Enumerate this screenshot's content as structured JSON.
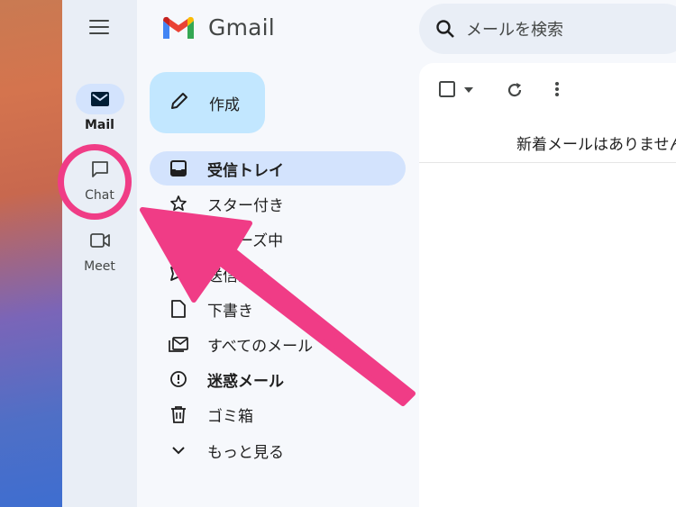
{
  "rail": {
    "items": [
      {
        "label": "Mail",
        "icon": "mail-icon"
      },
      {
        "label": "Chat",
        "icon": "chat-icon"
      },
      {
        "label": "Meet",
        "icon": "video-icon"
      }
    ]
  },
  "header": {
    "logo_text": "Gmail",
    "search_placeholder": "メールを検索"
  },
  "compose": {
    "label": "作成"
  },
  "nav": {
    "items": [
      {
        "label": "受信トレイ",
        "icon": "inbox-icon"
      },
      {
        "label": "スター付き",
        "icon": "star-icon"
      },
      {
        "label": "スヌーズ中",
        "icon": "clock-icon"
      },
      {
        "label": "送信済み",
        "icon": "send-icon"
      },
      {
        "label": "下書き",
        "icon": "draft-icon"
      },
      {
        "label": "すべてのメール",
        "icon": "all-mail-icon"
      },
      {
        "label": "迷惑メール",
        "icon": "spam-icon"
      },
      {
        "label": "ゴミ箱",
        "icon": "trash-icon"
      },
      {
        "label": "もっと見る",
        "icon": "chevron-down-icon"
      }
    ]
  },
  "main": {
    "empty_message": "新着メールはありません"
  },
  "colors": {
    "annotation": "#f03c86",
    "active_bg": "#d3e3fd",
    "compose_bg": "#c2e7ff"
  }
}
